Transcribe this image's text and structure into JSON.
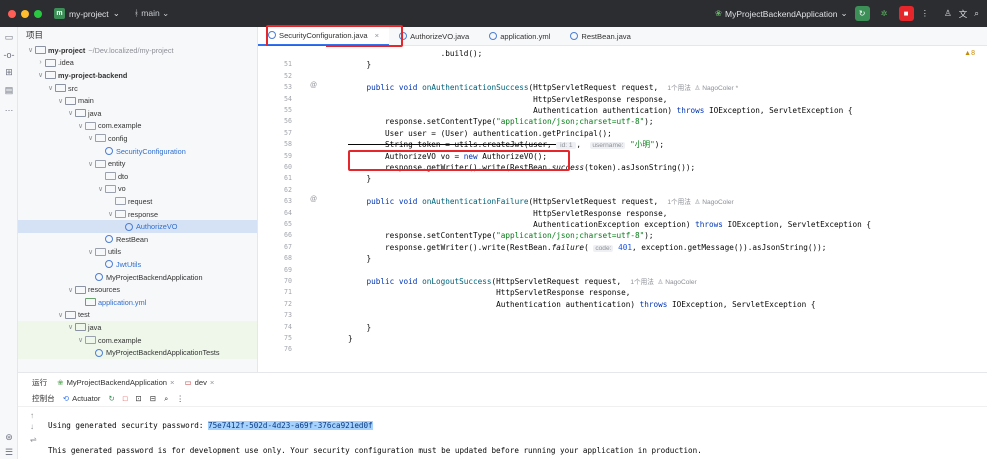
{
  "titlebar": {
    "project_badge": "m",
    "project": "my-project",
    "branch": "main",
    "run_config": "MyProjectBackendApplication",
    "icons": [
      "run-icon",
      "debug-icon",
      "stop-icon",
      "more-icon",
      "account-icon",
      "translate-icon",
      "search-icon"
    ]
  },
  "tree": {
    "header": "项目",
    "rows": [
      {
        "name": "my-project",
        "path": "~/Dev.localized/my-project",
        "indent": 0,
        "chev": "∨",
        "icon": "folder",
        "bold": true
      },
      {
        "name": ".idea",
        "indent": 1,
        "chev": "›",
        "icon": "folder"
      },
      {
        "name": "my-project-backend",
        "indent": 1,
        "chev": "∨",
        "icon": "folder",
        "bold": true
      },
      {
        "name": "src",
        "indent": 2,
        "chev": "∨",
        "icon": "folder"
      },
      {
        "name": "main",
        "indent": 3,
        "chev": "∨",
        "icon": "folder"
      },
      {
        "name": "java",
        "indent": 4,
        "chev": "∨",
        "icon": "folder"
      },
      {
        "name": "com.example",
        "indent": 5,
        "chev": "∨",
        "icon": "pkg"
      },
      {
        "name": "config",
        "indent": 6,
        "chev": "∨",
        "icon": "pkg"
      },
      {
        "name": "SecurityConfiguration",
        "indent": 7,
        "chev": "",
        "icon": "cls",
        "blue": true
      },
      {
        "name": "entity",
        "indent": 6,
        "chev": "∨",
        "icon": "pkg"
      },
      {
        "name": "dto",
        "indent": 7,
        "chev": "",
        "icon": "pkg"
      },
      {
        "name": "vo",
        "indent": 7,
        "chev": "∨",
        "icon": "pkg"
      },
      {
        "name": "request",
        "indent": 8,
        "chev": "",
        "icon": "pkg"
      },
      {
        "name": "response",
        "indent": 8,
        "chev": "∨",
        "icon": "pkg"
      },
      {
        "name": "AuthorizeVO",
        "indent": 9,
        "chev": "",
        "icon": "cls",
        "blue": true,
        "selected": true
      },
      {
        "name": "RestBean",
        "indent": 7,
        "chev": "",
        "icon": "cls"
      },
      {
        "name": "utils",
        "indent": 6,
        "chev": "∨",
        "icon": "pkg"
      },
      {
        "name": "JwtUtils",
        "indent": 7,
        "chev": "",
        "icon": "cls",
        "blue": true
      },
      {
        "name": "MyProjectBackendApplication",
        "indent": 6,
        "chev": "",
        "icon": "cls"
      },
      {
        "name": "resources",
        "indent": 4,
        "chev": "∨",
        "icon": "folder"
      },
      {
        "name": "application.yml",
        "indent": 5,
        "chev": "",
        "icon": "file",
        "blue": true
      },
      {
        "name": "test",
        "indent": 3,
        "chev": "∨",
        "icon": "folder"
      },
      {
        "name": "java",
        "indent": 4,
        "chev": "∨",
        "icon": "folder",
        "green": true
      },
      {
        "name": "com.example",
        "indent": 5,
        "chev": "∨",
        "icon": "pkg",
        "green": true
      },
      {
        "name": "MyProjectBackendApplicationTests",
        "indent": 6,
        "chev": "",
        "icon": "cls",
        "green": true
      }
    ]
  },
  "editor": {
    "tabs": [
      {
        "label": "SecurityConfiguration.java",
        "active": true,
        "closable": true
      },
      {
        "label": "AuthorizeVO.java"
      },
      {
        "label": "application.yml"
      },
      {
        "label": "RestBean.java"
      }
    ],
    "warning_badge": "▲8",
    "line_numbers": [
      "",
      "51",
      "52",
      "53",
      "54",
      "55",
      "56",
      "57",
      "58",
      "59",
      "60",
      "61",
      "62",
      "63",
      "64",
      "65",
      "66",
      "67",
      "68",
      "69",
      "70",
      "71",
      "72",
      "73",
      "74",
      "75",
      "76"
    ],
    "gutter_marks": {
      "53": "@",
      "63": "@"
    },
    "lines": [
      {
        "n": "",
        "segs": [
          {
            "t": "                    .build();"
          }
        ]
      },
      {
        "n": "51",
        "segs": [
          {
            "t": "    }"
          }
        ]
      },
      {
        "n": "52",
        "segs": [
          {
            "t": ""
          }
        ]
      },
      {
        "n": "53",
        "segs": [
          {
            "t": "    "
          },
          {
            "t": "public void ",
            "c": "kw"
          },
          {
            "t": "onAuthenticationSuccess",
            "c": "fn"
          },
          {
            "t": "(HttpServletRequest request,  "
          },
          {
            "t": "1个用法  ♙ NagoColer *",
            "c": "hint"
          }
        ]
      },
      {
        "n": "54",
        "segs": [
          {
            "t": "                                        HttpServletResponse response,"
          }
        ]
      },
      {
        "n": "55",
        "segs": [
          {
            "t": "                                        Authentication authentication) "
          },
          {
            "t": "throws ",
            "c": "kw"
          },
          {
            "t": "IOException, ServletException {"
          }
        ]
      },
      {
        "n": "56",
        "segs": [
          {
            "t": "        response.setContentType("
          },
          {
            "t": "\"application/json;charset=utf-8\"",
            "c": "st"
          },
          {
            "t": ");"
          }
        ]
      },
      {
        "n": "57",
        "segs": [
          {
            "t": "        User user = (User) authentication.getPrincipal();"
          }
        ]
      },
      {
        "n": "58",
        "segs": [
          {
            "t": "        String token = utils.createJwt(user, ",
            "c": "strike"
          },
          {
            "t": " id: 1 ",
            "c": "pill"
          },
          {
            "t": ",  "
          },
          {
            "t": "username:",
            "c": "pill"
          },
          {
            "t": " "
          },
          {
            "t": "\"小明\"",
            "c": "st"
          },
          {
            "t": ");"
          }
        ]
      },
      {
        "n": "59",
        "segs": [
          {
            "t": "        AuthorizeVO vo = "
          },
          {
            "t": "new ",
            "c": "kw"
          },
          {
            "t": "AuthorizeVO();"
          }
        ]
      },
      {
        "n": "60",
        "segs": [
          {
            "t": "        response.getWriter().write(RestBean."
          },
          {
            "t": "success",
            "c": "it"
          },
          {
            "t": "(token).asJsonString());"
          }
        ]
      },
      {
        "n": "61",
        "segs": [
          {
            "t": "    }"
          }
        ]
      },
      {
        "n": "62",
        "segs": [
          {
            "t": ""
          }
        ]
      },
      {
        "n": "63",
        "segs": [
          {
            "t": "    "
          },
          {
            "t": "public void ",
            "c": "kw"
          },
          {
            "t": "onAuthenticationFailure",
            "c": "fn"
          },
          {
            "t": "(HttpServletRequest request,  "
          },
          {
            "t": "1个用法  ♙ NagoColer",
            "c": "hint"
          }
        ]
      },
      {
        "n": "64",
        "segs": [
          {
            "t": "                                        HttpServletResponse response,"
          }
        ]
      },
      {
        "n": "65",
        "segs": [
          {
            "t": "                                        AuthenticationException exception) "
          },
          {
            "t": "throws ",
            "c": "kw"
          },
          {
            "t": "IOException, ServletException {"
          }
        ]
      },
      {
        "n": "66",
        "segs": [
          {
            "t": "        response.setContentType("
          },
          {
            "t": "\"application/json;charset=utf-8\"",
            "c": "st"
          },
          {
            "t": ");"
          }
        ]
      },
      {
        "n": "67",
        "segs": [
          {
            "t": "        response.getWriter().write(RestBean."
          },
          {
            "t": "failure",
            "c": "it"
          },
          {
            "t": "( "
          },
          {
            "t": "code:",
            "c": "pill"
          },
          {
            "t": " "
          },
          {
            "t": "401",
            "c": "nm"
          },
          {
            "t": ", exception.getMessage()).asJsonString());"
          }
        ]
      },
      {
        "n": "68",
        "segs": [
          {
            "t": "    }"
          }
        ]
      },
      {
        "n": "69",
        "segs": [
          {
            "t": ""
          }
        ]
      },
      {
        "n": "70",
        "segs": [
          {
            "t": "    "
          },
          {
            "t": "public void ",
            "c": "kw"
          },
          {
            "t": "onLogoutSuccess",
            "c": "fn"
          },
          {
            "t": "(HttpServletRequest request,  "
          },
          {
            "t": "1个用法  ♙ NagoColer",
            "c": "hint"
          }
        ]
      },
      {
        "n": "71",
        "segs": [
          {
            "t": "                                HttpServletResponse response,"
          }
        ]
      },
      {
        "n": "72",
        "segs": [
          {
            "t": "                                Authentication authentication) "
          },
          {
            "t": "throws ",
            "c": "kw"
          },
          {
            "t": "IOException, ServletException {"
          }
        ]
      },
      {
        "n": "73",
        "segs": [
          {
            "t": ""
          }
        ]
      },
      {
        "n": "74",
        "segs": [
          {
            "t": "    }"
          }
        ]
      },
      {
        "n": "75",
        "segs": [
          {
            "t": "}"
          }
        ]
      },
      {
        "n": "76",
        "segs": [
          {
            "t": ""
          }
        ]
      }
    ]
  },
  "run": {
    "title": "运行",
    "config_tab": "MyProjectBackendApplication",
    "dev_tab": "dev",
    "console_tab": "控制台",
    "actuator_tab": "Actuator",
    "console": {
      "line1_prefix": "Using generated security password: ",
      "password": "75e7412f-502d-4d23-a69f-376ca921ed0f",
      "line2": "This generated password is for development use only. Your security configuration must be updated before running your application in production."
    }
  },
  "colors": {
    "titlebar_bg": "#2b2d30",
    "accent": "#3574f0",
    "highlight_box": "#e5262a",
    "selection": "#d5e1f5"
  }
}
